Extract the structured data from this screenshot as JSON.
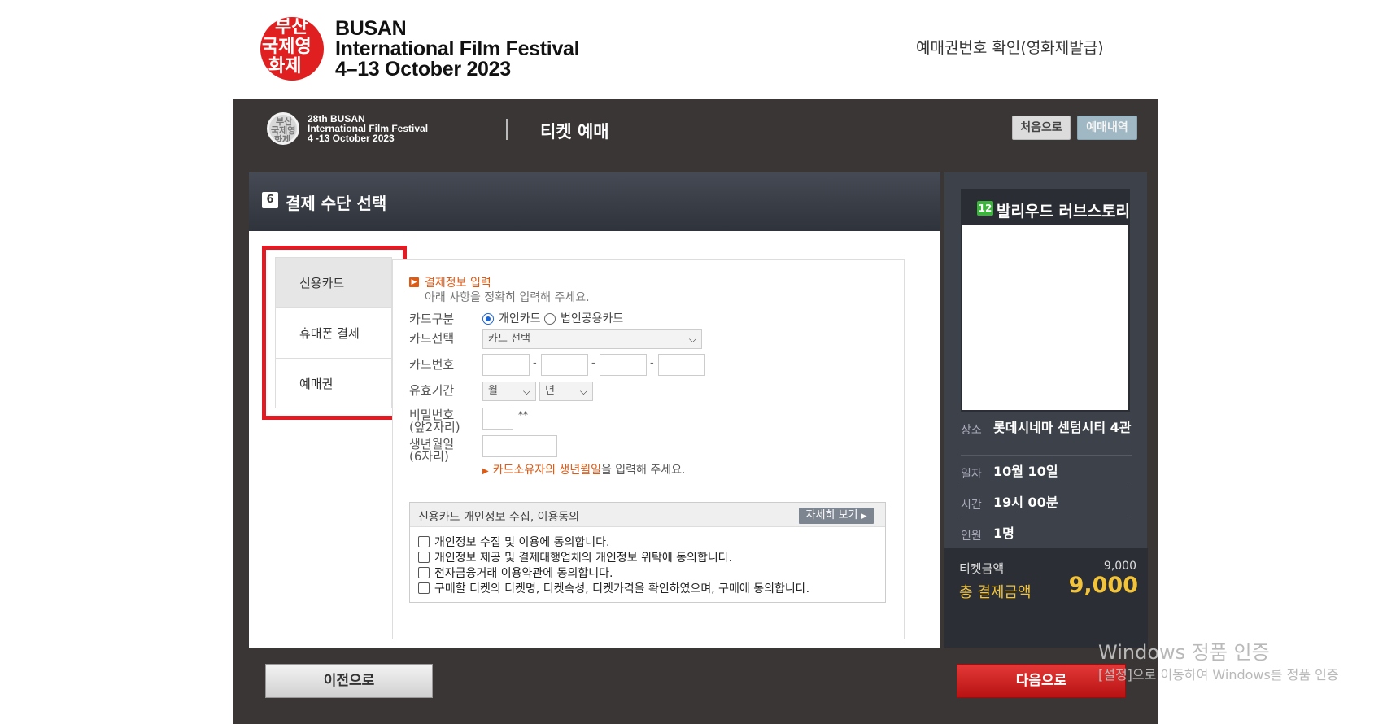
{
  "site": {
    "logo_line1": "BUSAN",
    "logo_line2": "International Film Festival",
    "logo_line3": "4–13 October 2023",
    "top_link": "예매권번호 확인(영화제발급)"
  },
  "header": {
    "logo_line1": "28th BUSAN",
    "logo_line2": "International Film Festival",
    "logo_line3": "4 -13 October 2023",
    "title": "티켓 예매",
    "home_button": "처음으로",
    "history_button": "예매내역"
  },
  "step": {
    "number": "6",
    "title": "결제 수단 선택"
  },
  "tabs": [
    {
      "label": "신용카드",
      "active": true
    },
    {
      "label": "휴대폰 결제",
      "active": false
    },
    {
      "label": "예매권",
      "active": false
    }
  ],
  "form": {
    "section_title": "결제정보 입력",
    "section_subtitle": "아래 사항을 정확히 입력해 주세요.",
    "card_type_label": "카드구분",
    "card_type_option1": "개인카드",
    "card_type_option2": "법인공용카드",
    "card_select_label": "카드선택",
    "card_select_value": "카드 선택",
    "card_number_label": "카드번호",
    "dash": "-",
    "expiry_label": "유효기간",
    "expiry_month": "월",
    "expiry_year": "년",
    "password_label_1": "비밀번호",
    "password_label_2": "(앞2자리)",
    "password_suffix": "**",
    "birth_label_1": "생년월일",
    "birth_label_2": "(6자리)",
    "note_highlight": "카드소유자의 생년월일",
    "note_rest": "을 입력해 주세요."
  },
  "consent": {
    "title": "신용카드 개인정보 수집, 이용동의",
    "detail_button": "자세히 보기",
    "items": [
      "개인정보 수집 및 이용에 동의합니다.",
      "개인정보 제공 및 결제대행업체의 개인정보 위탁에 동의합니다.",
      "전자금융거래 이용약관에 동의합니다.",
      "구매할 티켓의 티켓명, 티켓속성, 티켓가격을 확인하였으며, 구매에 동의합니다."
    ]
  },
  "buttons": {
    "prev": "이전으로",
    "next": "다음으로"
  },
  "sidebar": {
    "age_rating": "12",
    "movie_title": "발리우드 러브스토리",
    "venue_label": "장소",
    "venue_value": "롯데시네마 센텀시티 4관",
    "date_label": "일자",
    "date_value": "10월 10일",
    "time_label": "시간",
    "time_value": "19시 00분",
    "people_label": "인원",
    "people_value": "1명",
    "ticket_price_label": "티켓금액",
    "ticket_price_value": "9,000",
    "total_label": "총 결제금액",
    "total_value": "9,000"
  },
  "watermark": {
    "line1": "Windows 정품 인증",
    "line2": "[설정]으로 이동하여 Windows를 정품 인증"
  },
  "colors": {
    "frame_bg": "#3a3635",
    "accent_orange": "#e05a12",
    "highlight_red": "#e01b23",
    "next_button": "#c91d1d",
    "total_yellow": "#f3c43a"
  }
}
